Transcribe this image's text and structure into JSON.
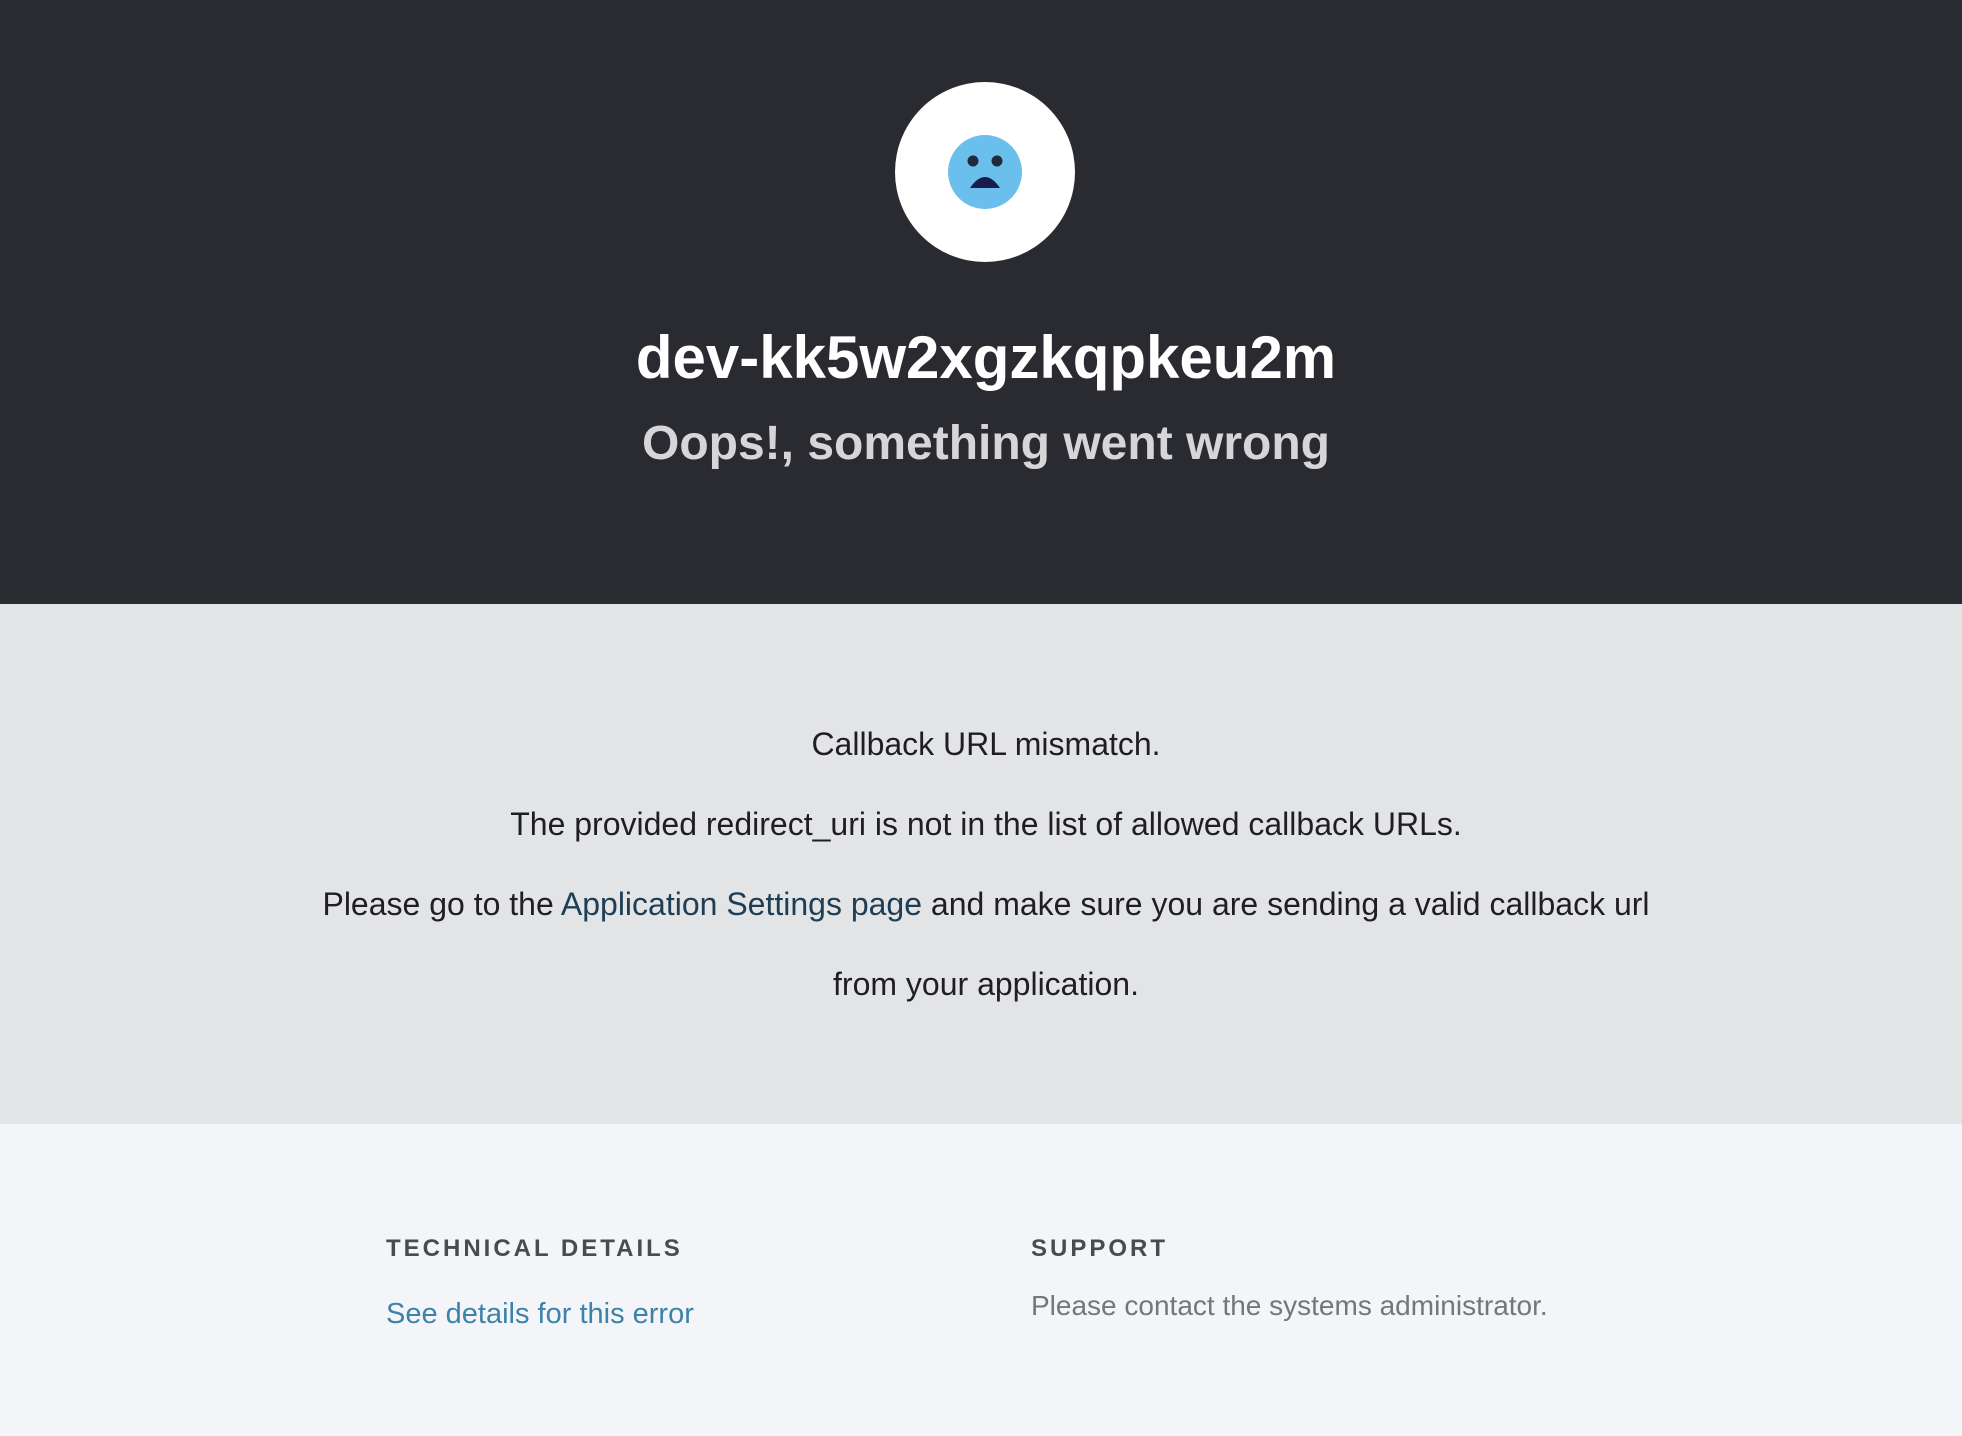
{
  "header": {
    "tenant_name": "dev-kk5w2xgzkqpkeu2m",
    "subtitle": "Oops!, something went wrong",
    "avatar_icon": "sad-face-icon",
    "icon_color": "#6bbfec"
  },
  "message": {
    "line1": "Callback URL mismatch.",
    "line2": "The provided redirect_uri is not in the list of allowed callback URLs.",
    "line3_prefix": "Please go to the ",
    "line3_link": "Application Settings page",
    "line3_suffix": " and make sure you are sending a valid callback url",
    "line4": "from your application."
  },
  "footer": {
    "technical_title": "TECHNICAL DETAILS",
    "technical_link": "See details for this error",
    "support_title": "SUPPORT",
    "support_text": "Please contact the systems administrator."
  }
}
